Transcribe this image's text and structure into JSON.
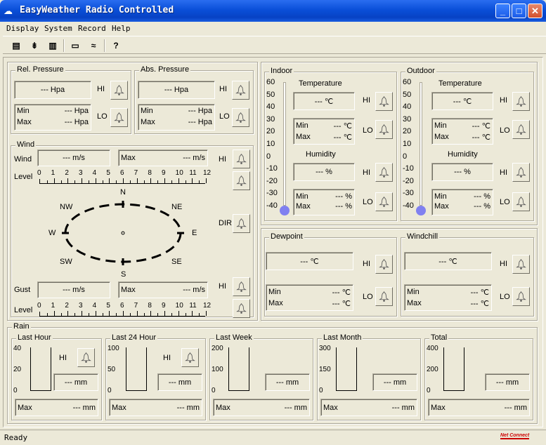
{
  "window": {
    "title": "EasyWeather Radio Controlled",
    "min": "_",
    "max": "□",
    "close": "✕"
  },
  "menu": [
    "Display",
    "System",
    "Record",
    "Help"
  ],
  "pressure": {
    "rel_label": "Rel. Pressure",
    "abs_label": "Abs. Pressure",
    "value": "--- Hpa",
    "min_label": "Min",
    "max_label": "Max",
    "hi": "HI",
    "lo": "LO"
  },
  "wind": {
    "label": "Wind",
    "wind_label": "Wind",
    "value": "--- m/s",
    "max_label": "Max",
    "level_label": "Level",
    "gust_label": "Gust",
    "hi": "HI",
    "dir": "DIR",
    "levels": [
      "0",
      "1",
      "2",
      "3",
      "4",
      "5",
      "6",
      "7",
      "8",
      "9",
      "10",
      "11",
      "12"
    ],
    "compass": {
      "n": "N",
      "ne": "NE",
      "e": "E",
      "se": "SE",
      "s": "S",
      "sw": "SW",
      "w": "W",
      "nw": "NW"
    }
  },
  "indoor": {
    "label": "Indoor",
    "temp_label": "Temperature",
    "temp_value": "--- ℃",
    "hum_label": "Humidity",
    "hum_value": "--- %",
    "min_label": "Min",
    "max_label": "Max",
    "hi": "HI",
    "lo": "LO",
    "scale": [
      "60",
      "50",
      "40",
      "30",
      "20",
      "10",
      "0",
      "-10",
      "-20",
      "-30",
      "-40"
    ]
  },
  "outdoor": {
    "label": "Outdoor",
    "temp_label": "Temperature",
    "temp_value": "--- ℃",
    "hum_label": "Humidity",
    "hum_value": "--- %",
    "min_label": "Min",
    "max_label": "Max",
    "hi": "HI",
    "lo": "LO",
    "scale": [
      "60",
      "50",
      "40",
      "30",
      "20",
      "10",
      "0",
      "-10",
      "-20",
      "-30",
      "-40"
    ]
  },
  "dewpoint": {
    "label": "Dewpoint",
    "value": "--- ℃",
    "min_label": "Min",
    "max_label": "Max",
    "hi": "HI",
    "lo": "LO"
  },
  "windchill": {
    "label": "Windchill",
    "value": "--- ℃",
    "min_label": "Min",
    "max_label": "Max",
    "hi": "HI",
    "lo": "LO"
  },
  "rain": {
    "label": "Rain",
    "value": "--- mm",
    "max_label": "Max",
    "hi": "HI",
    "panels": [
      {
        "label": "Last Hour",
        "scale": [
          "40",
          "20",
          "0"
        ]
      },
      {
        "label": "Last 24 Hour",
        "scale": [
          "100",
          "50",
          "0"
        ]
      },
      {
        "label": "Last Week",
        "scale": [
          "200",
          "100",
          "0"
        ]
      },
      {
        "label": "Last Month",
        "scale": [
          "300",
          "150",
          "0"
        ]
      },
      {
        "label": "Total",
        "scale": [
          "400",
          "200",
          "0"
        ]
      }
    ]
  },
  "status": {
    "text": "Ready",
    "logo": "Net Connect"
  },
  "colors": {
    "titlebar": "#0a4fd8",
    "face": "#ece9d8",
    "bulb": "#8080f0"
  }
}
